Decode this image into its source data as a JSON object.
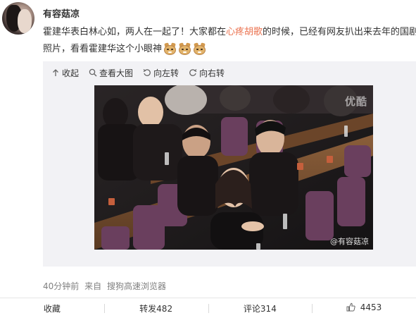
{
  "user": {
    "name": "有容菇凉"
  },
  "post": {
    "line1_before": "霍建华表白林心如，两人在一起了！大家都在",
    "topic": "心疼胡歌",
    "line1_after": "的时候，已经有网友扒出来去年的国剧盛",
    "line2": "照片，看看霍建华这个小眼神",
    "emoji_names": [
      "doge-icon",
      "doge-icon",
      "doge-icon"
    ]
  },
  "media_toolbar": {
    "collapse": "收起",
    "view_large": "查看大图",
    "rotate_left": "向左转",
    "rotate_right": "向右转"
  },
  "photo": {
    "watermark_top": "优酷",
    "watermark_bottom": "@有容菇凉"
  },
  "meta": {
    "time": "40分钟前",
    "from": "来自",
    "client": "搜狗高速浏览器"
  },
  "actions": {
    "favorite": "收藏",
    "repost": "转发482",
    "comment": "评论314",
    "like_count": "4453"
  },
  "colors": {
    "topic_link": "#eb7350",
    "meta_gray": "#808080",
    "toolbar_bg": "#f2f2f5"
  }
}
